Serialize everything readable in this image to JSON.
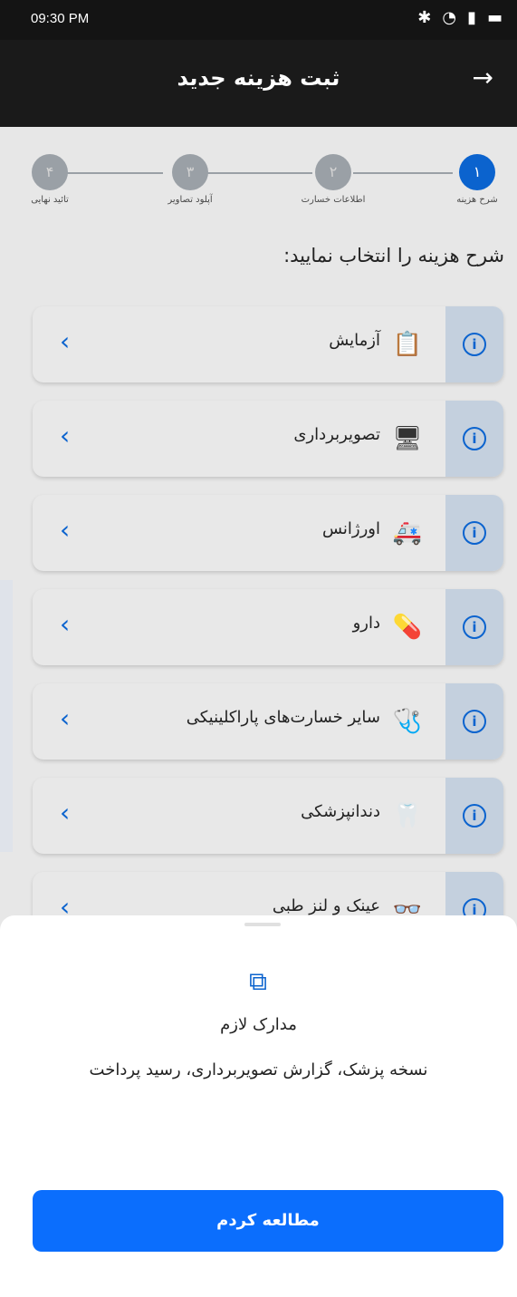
{
  "status_bar": {
    "time": "09:30 PM",
    "icons": [
      "bluetooth-icon",
      "wifi-icon",
      "signal-icon",
      "battery-icon"
    ]
  },
  "app_bar": {
    "title": "ثبت هزینه جدید",
    "back_icon": "arrow-right-icon"
  },
  "stepper": {
    "steps": [
      {
        "number": "۱",
        "label": "شرح هزینه",
        "active": true
      },
      {
        "number": "۲",
        "label": "اطلاعات خسارت",
        "active": false
      },
      {
        "number": "۳",
        "label": "آپلود تصاویر",
        "active": false
      },
      {
        "number": "۴",
        "label": "تائید نهایی",
        "active": false
      }
    ]
  },
  "main": {
    "section_title": "شرح هزینه را انتخاب نمایید:",
    "items": [
      {
        "label": "آزمایش",
        "icon": "clipboard-list-icon"
      },
      {
        "label": "تصویربرداری",
        "icon": "monitor-plus-icon"
      },
      {
        "label": "اورژانس",
        "icon": "ambulance-icon"
      },
      {
        "label": "دارو",
        "icon": "pill-icon"
      },
      {
        "label": "سایر خسارت‌های پاراکلینیکی",
        "icon": "hand-medical-icon"
      },
      {
        "label": "دندانپزشکی",
        "icon": "tooth-icon"
      },
      {
        "label": "عینک و لنز طبی",
        "icon": "glasses-icon"
      }
    ]
  },
  "bottom_sheet": {
    "icon": "documents-icon",
    "title": "مدارک لازم",
    "description": "نسخه پزشک، گزارش تصویربرداری، رسید پرداخت",
    "button_label": "مطالعه کردم"
  },
  "colors": {
    "primary": "#0b6efd",
    "step_active": "#0b63ce",
    "info_box": "#c4d0de"
  }
}
